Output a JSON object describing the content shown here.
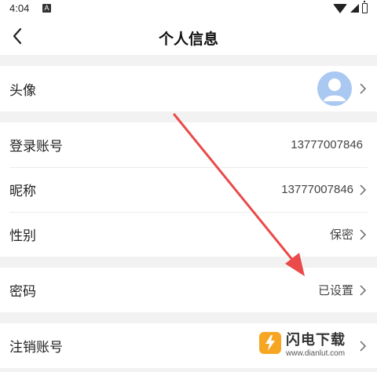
{
  "status_bar": {
    "time": "4:04",
    "notification_glyph": "A"
  },
  "header": {
    "title": "个人信息"
  },
  "rows": {
    "avatar": {
      "label": "头像"
    },
    "account": {
      "label": "登录账号",
      "value": "13777007846"
    },
    "nickname": {
      "label": "昵称",
      "value": "13777007846"
    },
    "gender": {
      "label": "性别",
      "value": "保密"
    },
    "password": {
      "label": "密码",
      "value": "已设置"
    },
    "cancel": {
      "label": "注销账号"
    }
  },
  "watermark": {
    "name": "闪电下载",
    "url": "www.dianlut.com"
  },
  "colors": {
    "annotation_arrow": "#ea4a4a",
    "avatar_bg": "#a9c8f2"
  }
}
